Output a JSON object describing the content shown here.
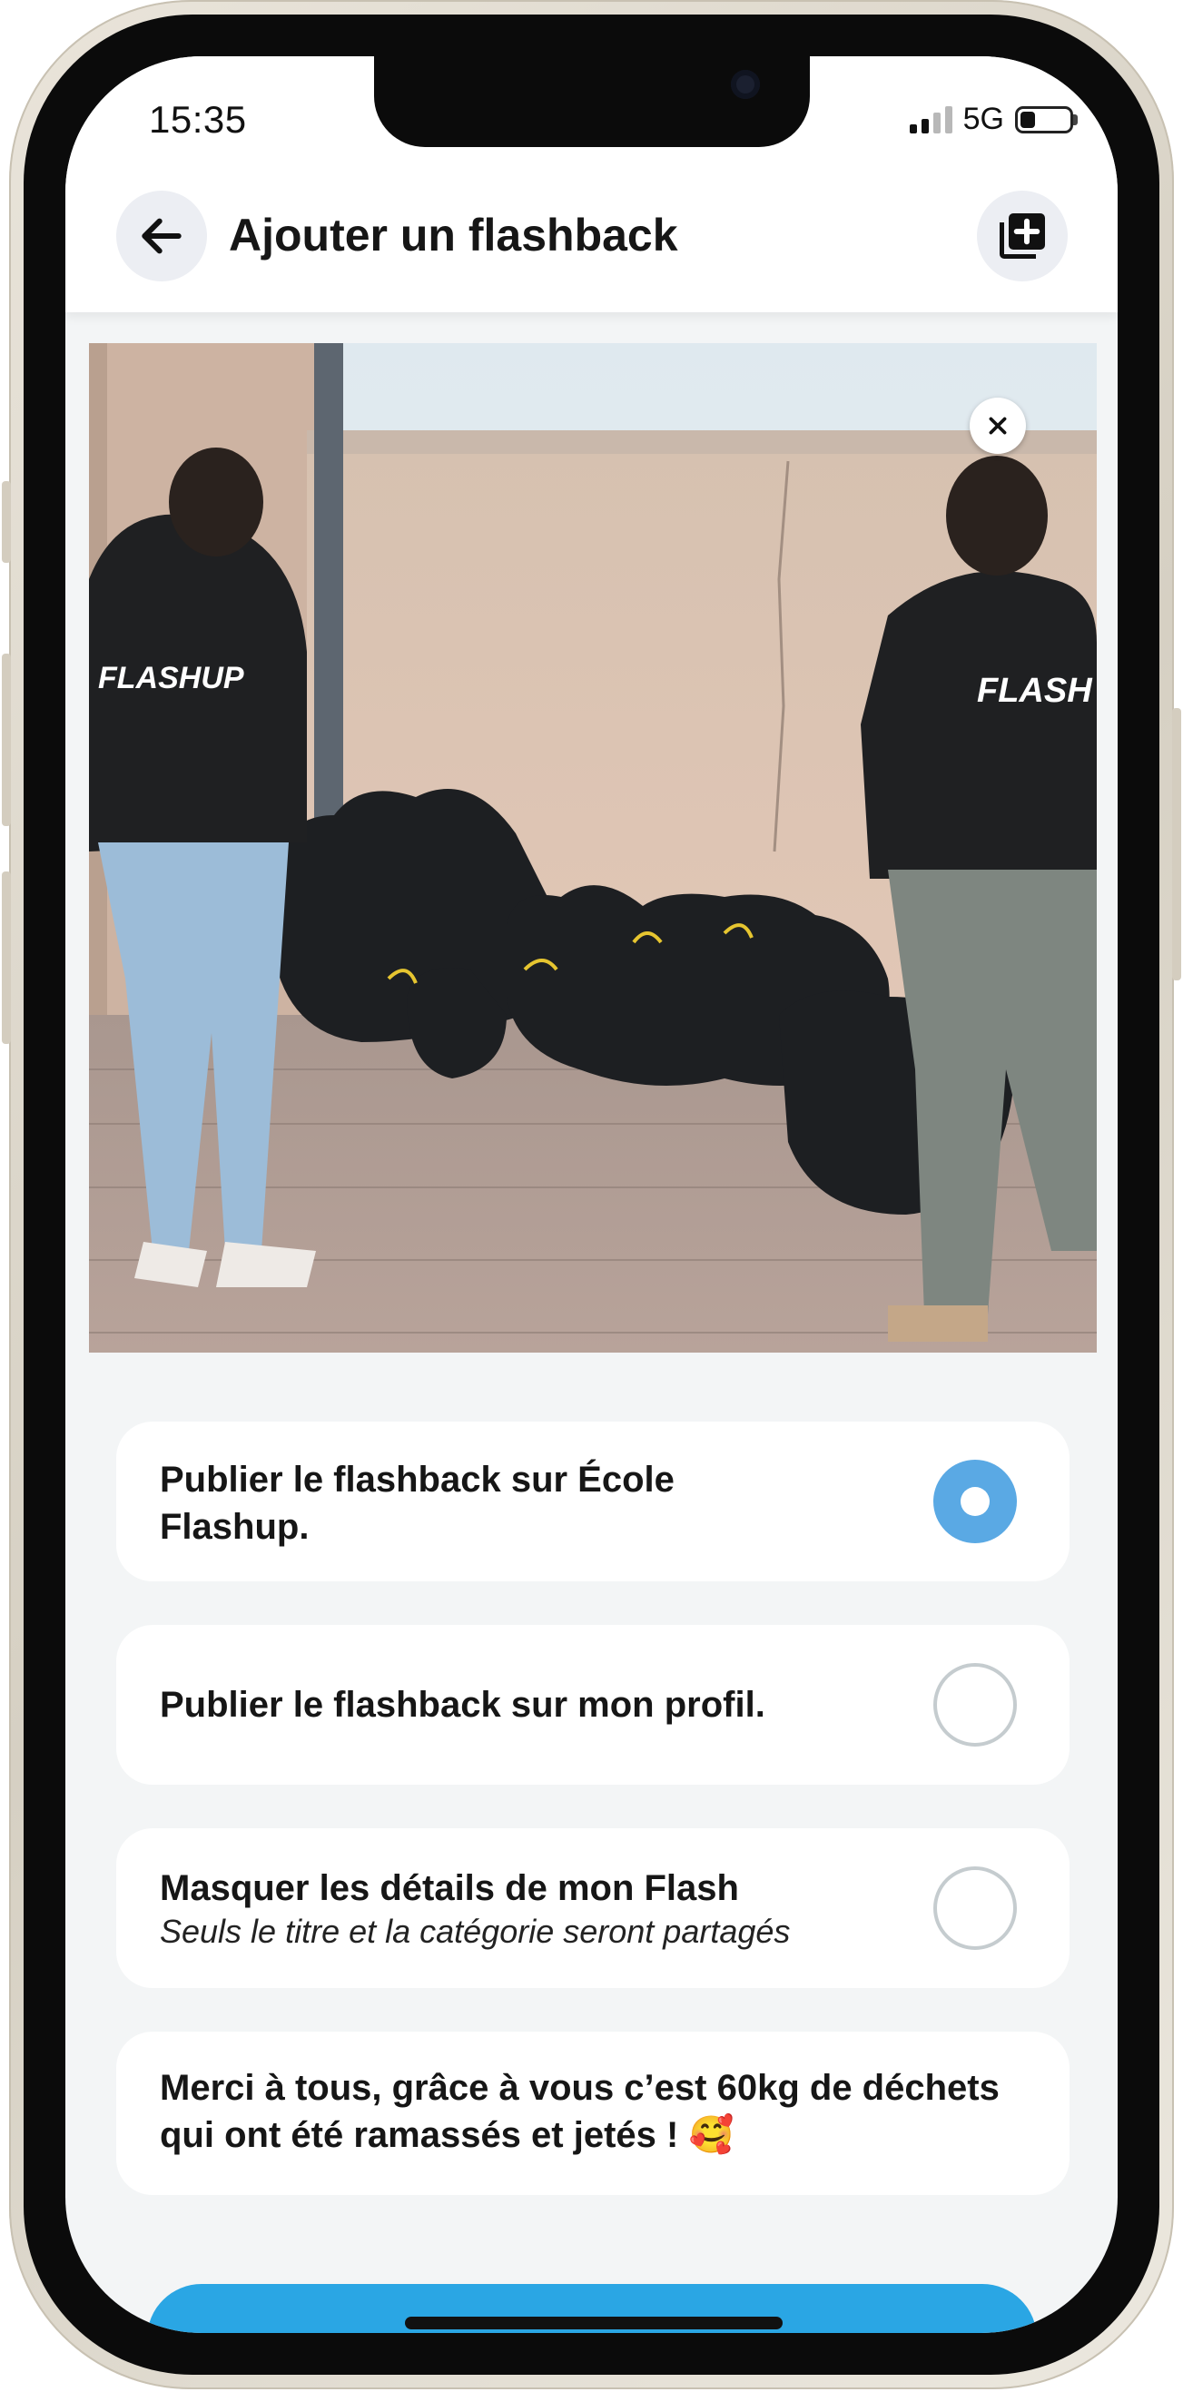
{
  "status_bar": {
    "time": "15:35",
    "network": "5G",
    "signal_bars": 2,
    "battery_level": 0.3,
    "icons": [
      "signal-icon",
      "battery-icon"
    ]
  },
  "header": {
    "title": "Ajouter un flashback",
    "back_icon": "arrow-left-icon",
    "add_icon": "add-to-library-icon"
  },
  "photo": {
    "hoodie_text_left": "FLASHUP",
    "hoodie_text_right": "FLASH",
    "remove_icon": "close-icon"
  },
  "options": [
    {
      "label": "Publier le flashback sur École Flashup.",
      "selected": true
    },
    {
      "label": "Publier le flashback sur mon profil.",
      "selected": false
    },
    {
      "label": "Masquer les détails de mon Flash",
      "sublabel": "Seuls le titre et la catégorie seront partagés",
      "selected": false
    }
  ],
  "message": {
    "text": "Merci à tous, grâce à vous c’est 60kg de déchets qui ont été ramassés et jetés ! 🥰"
  },
  "colors": {
    "accent": "#5aa9e4",
    "primary_button": "#2aa6e4",
    "background": "#f3f5f6",
    "card": "#ffffff"
  }
}
